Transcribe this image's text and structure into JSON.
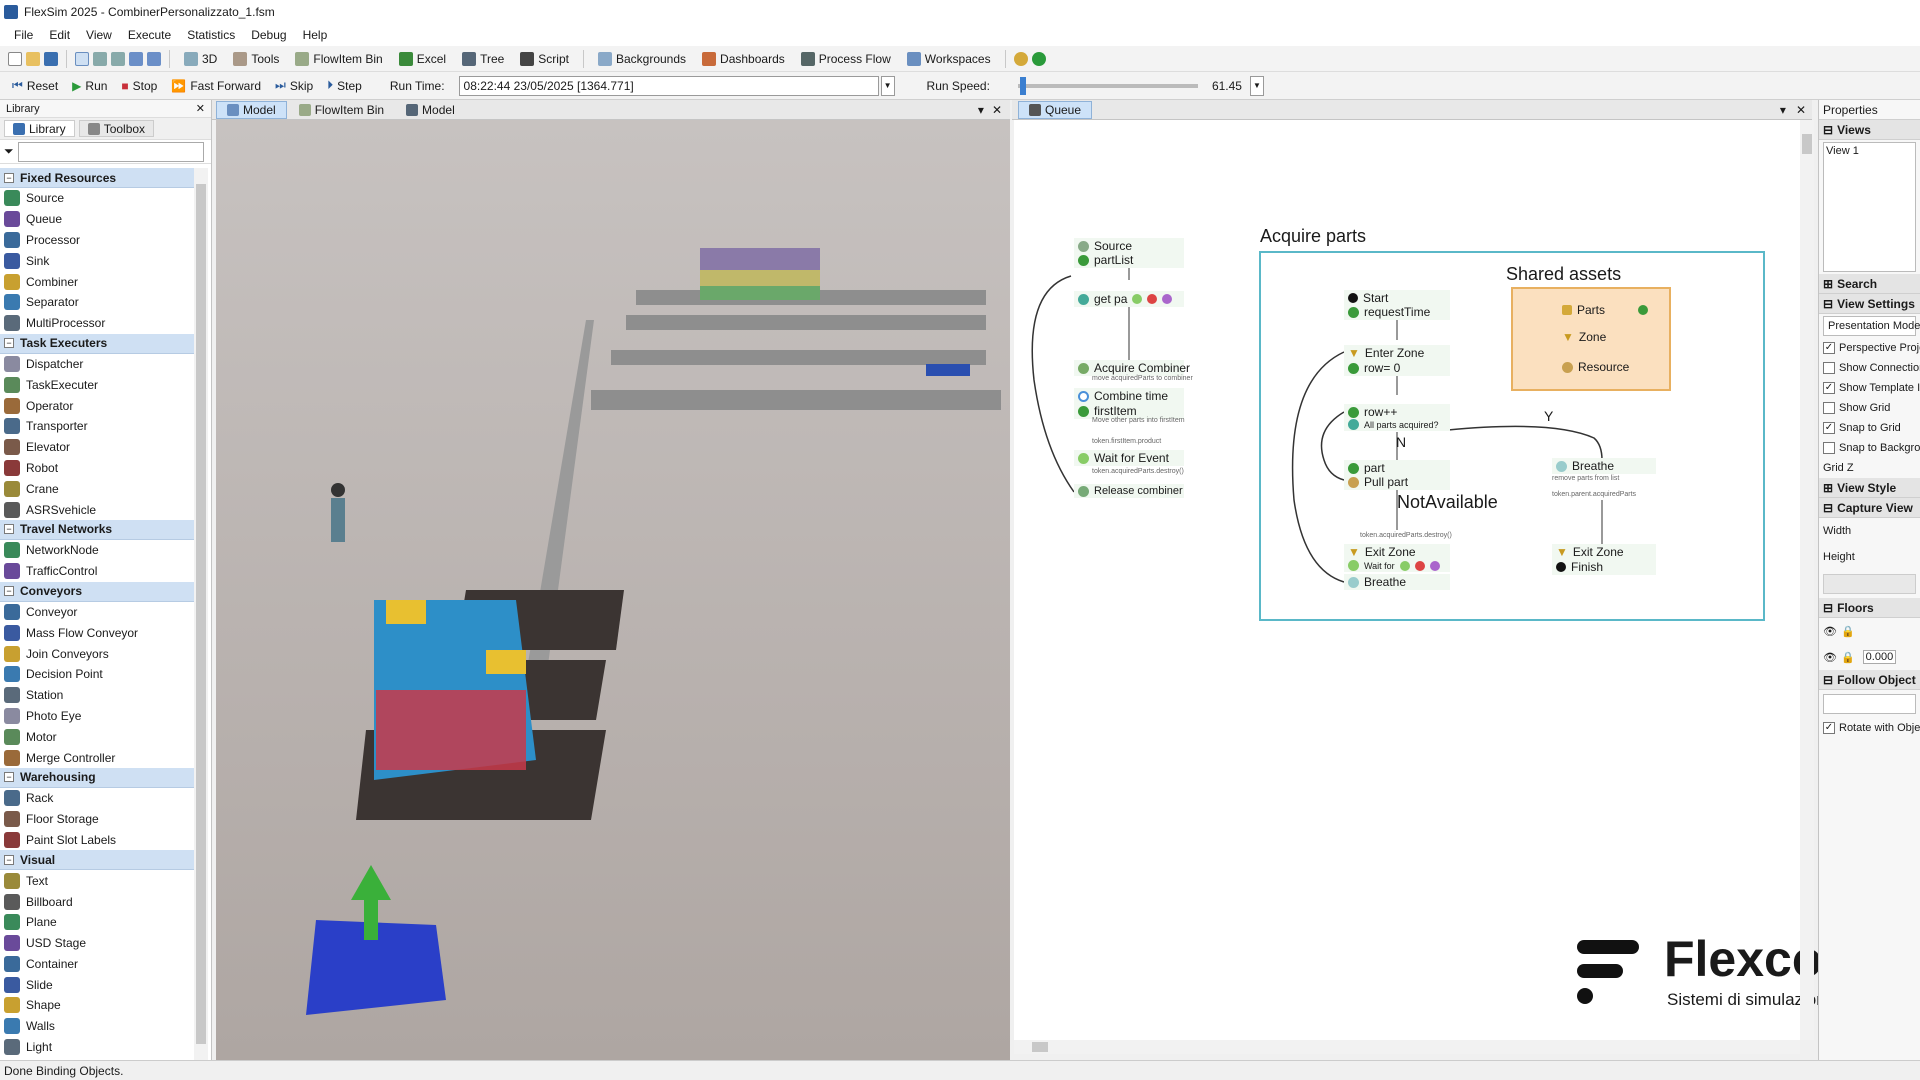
{
  "window": {
    "title": "FlexSim 2025 - CombinerPersonalizzato_1.fsm"
  },
  "menu": [
    "File",
    "Edit",
    "View",
    "Execute",
    "Statistics",
    "Debug",
    "Help"
  ],
  "toolbar": {
    "items": [
      "3D",
      "Tools",
      "FlowItem Bin",
      "Excel",
      "Tree",
      "Script",
      "Backgrounds",
      "Dashboards",
      "Process Flow",
      "Workspaces"
    ]
  },
  "runbar": {
    "reset": "Reset",
    "run": "Run",
    "stop": "Stop",
    "fast_forward": "Fast Forward",
    "skip": "Skip",
    "step": "Step",
    "run_time_label": "Run Time:",
    "run_time_value": "08:22:44  23/05/2025  [1364.771]",
    "run_speed_label": "Run Speed:",
    "run_speed_value": "61.45"
  },
  "library": {
    "header": "Library",
    "tabs": [
      "Library",
      "Toolbox"
    ],
    "categories": [
      {
        "name": "Fixed Resources",
        "items": [
          "Source",
          "Queue",
          "Processor",
          "Sink",
          "Combiner",
          "Separator",
          "MultiProcessor"
        ]
      },
      {
        "name": "Task Executers",
        "items": [
          "Dispatcher",
          "TaskExecuter",
          "Operator",
          "Transporter",
          "Elevator",
          "Robot",
          "Crane",
          "ASRSvehicle"
        ]
      },
      {
        "name": "Travel Networks",
        "items": [
          "NetworkNode",
          "TrafficControl"
        ]
      },
      {
        "name": "Conveyors",
        "items": [
          "Conveyor",
          "Mass Flow Conveyor",
          "Join Conveyors",
          "Decision Point",
          "Station",
          "Photo Eye",
          "Motor",
          "Merge Controller"
        ]
      },
      {
        "name": "Warehousing",
        "items": [
          "Rack",
          "Floor Storage",
          "Paint Slot Labels"
        ]
      },
      {
        "name": "Visual",
        "items": [
          "Text",
          "Billboard",
          "Plane",
          "USD Stage",
          "Container",
          "Slide",
          "Shape",
          "Walls",
          "Light"
        ]
      }
    ]
  },
  "doc_tabs": [
    "Model",
    "FlowItem Bin",
    "Model"
  ],
  "pf_tab": "Queue",
  "process_flow": {
    "left": {
      "source": "Source",
      "partlist": "partList",
      "getpa": "get pa",
      "acquire_combiner": "Acquire Combiner",
      "acquire_sub": "move acquiredParts to combiner",
      "combine_time": "Combine time",
      "first_item": "firstItem",
      "first_sub": "Move other parts into firstItem",
      "token_sub": "token.firstItem.product",
      "wait_event": "Wait for Event",
      "wait_sub": "token.acquiredParts.destroy()",
      "release": "Release combiner"
    },
    "acquire_title": "Acquire parts",
    "shared_title": "Shared assets",
    "shared": [
      "Parts",
      "Zone",
      "Resource"
    ],
    "main": {
      "start": "Start",
      "request": "requestTime",
      "enter_zone": "Enter Zone",
      "row0": "row= 0",
      "rowpp": "row++",
      "all_parts": "All parts acquired?",
      "n": "N",
      "y": "Y",
      "part": "part",
      "pull_part": "Pull part",
      "notavail": "NotAvailable",
      "exit_sub": "token.acquiredParts.destroy()",
      "exit_zone": "Exit Zone",
      "wait_for": "Wait for",
      "breathe": "Breathe",
      "breathe2": "Breathe",
      "remove_sub": "remove parts from list",
      "token_acq": "token.parent.acquiredParts",
      "exit_zone2": "Exit Zone",
      "finish": "Finish"
    }
  },
  "logo": {
    "name": "Flexcon",
    "tagline": "Sistemi di simulazione"
  },
  "properties": {
    "header": "Properties",
    "views": "Views",
    "view1": "View 1",
    "search": "Search",
    "view_settings": "View Settings",
    "presentation_mode": "Presentation Mode",
    "checks": [
      {
        "label": "Perspective Projection",
        "checked": true
      },
      {
        "label": "Show Connections",
        "checked": false
      },
      {
        "label": "Show Template Items",
        "checked": true
      },
      {
        "label": "Show Grid",
        "checked": false
      },
      {
        "label": "Snap to Grid",
        "checked": true
      },
      {
        "label": "Snap to Background",
        "checked": false
      }
    ],
    "grid_z": "Grid Z",
    "view_style": "View Style",
    "capture_view": "Capture View",
    "width": "Width",
    "height": "Height",
    "floors": "Floors",
    "floor_val": "0.000",
    "follow_object": "Follow Object",
    "rotate": "Rotate with Object"
  },
  "status": "Done Binding Objects."
}
